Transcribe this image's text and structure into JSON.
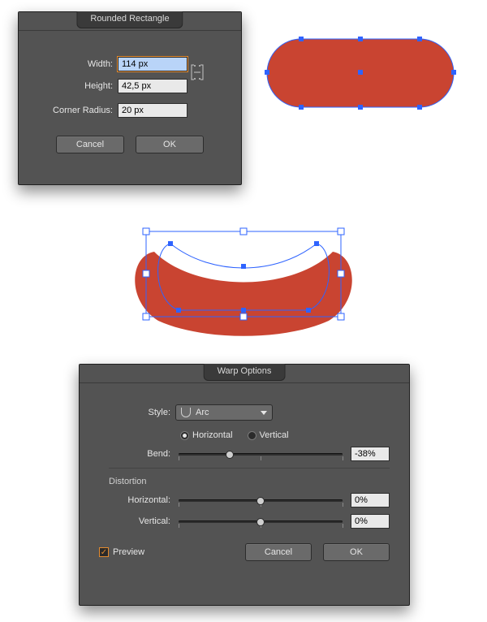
{
  "colors": {
    "shape": "#c94431",
    "selection": "#2e63ff"
  },
  "dialogRR": {
    "title": "Rounded Rectangle",
    "widthLabel": "Width:",
    "heightLabel": "Height:",
    "cornerLabel": "Corner Radius:",
    "width": "114 px",
    "height": "42,5 px",
    "corner": "20 px",
    "cancel": "Cancel",
    "ok": "OK"
  },
  "dialogWarp": {
    "title": "Warp Options",
    "styleLabel": "Style:",
    "styleValue": "Arc",
    "horizOpt": "Horizontal",
    "vertOpt": "Vertical",
    "orientation": "Horizontal",
    "bendLabel": "Bend:",
    "bendValue": "-38%",
    "bendPct": -38,
    "distortionTitle": "Distortion",
    "distHLabel": "Horizontal:",
    "distHValue": "0%",
    "distHPct": 0,
    "distVLabel": "Vertical:",
    "distVValue": "0%",
    "distVPct": 0,
    "previewLabel": "Preview",
    "previewChecked": true,
    "cancel": "Cancel",
    "ok": "OK"
  }
}
